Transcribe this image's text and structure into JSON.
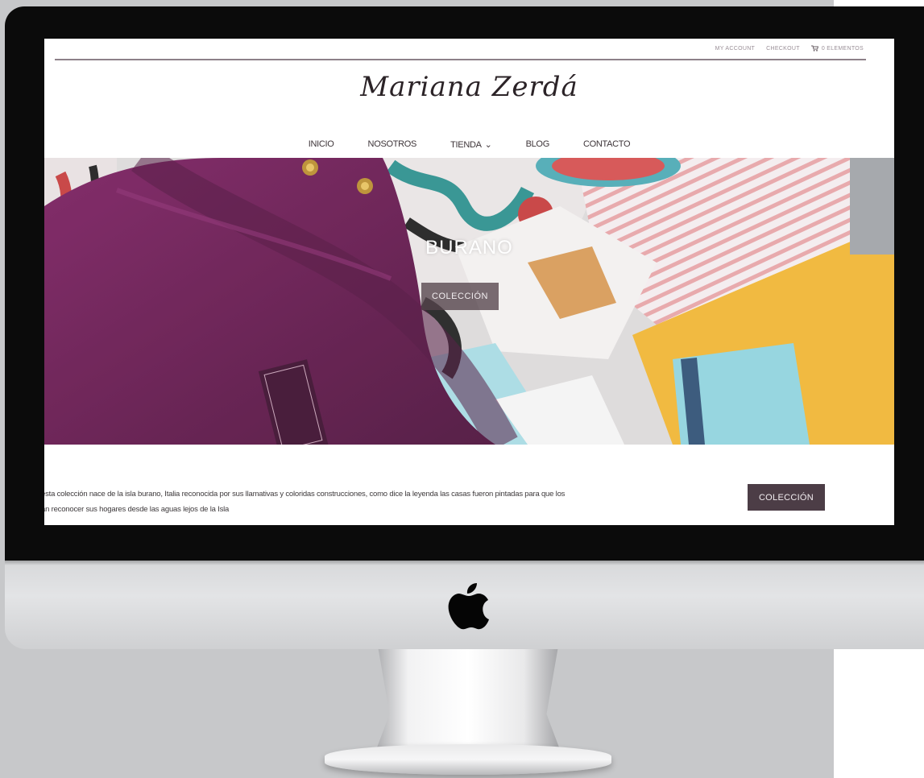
{
  "topbar": {
    "my_account": "MY ACCOUNT",
    "checkout": "CHECKOUT",
    "cart_count": "0 ELEMENTOS"
  },
  "brand": {
    "logo_text": "Mariana Zerdá"
  },
  "nav": {
    "items": [
      "INICIO",
      "NOSOTROS",
      "TIENDA",
      "BLOG",
      "CONTACTO"
    ]
  },
  "hero": {
    "title": "BURANO",
    "button_label": "COLECCIÓN"
  },
  "description": {
    "line1": "esta colección nace de la isla burano, Italia reconocida por sus llamativas y coloridas construcciones, como dice la leyenda las casas fueron pintadas para que los",
    "line2": "an reconocer sus hogares desde las aguas lejos de la Isla",
    "button_label": "COLECCIÓN"
  },
  "colors": {
    "accent": "#4c3d46",
    "bag_purple": "#6a1650",
    "mustard": "#f0b531",
    "light_blue": "#8fd3de"
  },
  "icons": [
    "cart-icon",
    "chevron-down-icon",
    "apple-logo-icon"
  ]
}
